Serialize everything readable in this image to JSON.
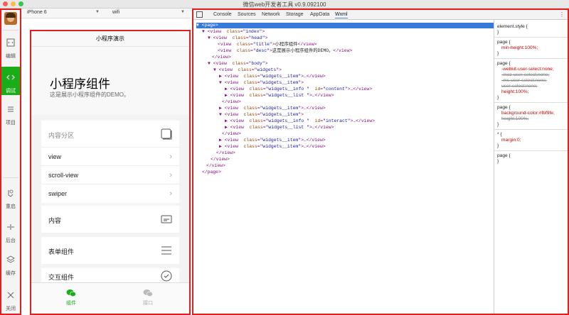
{
  "window": {
    "title": "微信web开发者工具 v0.9.092100"
  },
  "sidebar": {
    "items": [
      {
        "label": "编辑",
        "icon": "code-box-icon"
      },
      {
        "label": "调试",
        "icon": "code-brackets-icon",
        "active": true
      },
      {
        "label": "项目",
        "icon": "list-icon"
      },
      {
        "label": "重启",
        "icon": "restart-icon"
      },
      {
        "label": "后台",
        "icon": "background-icon"
      },
      {
        "label": "缓存",
        "icon": "layers-icon"
      },
      {
        "label": "关闭",
        "icon": "close-icon"
      }
    ]
  },
  "simulator": {
    "device": "iPhone 6",
    "network": "wifi",
    "nav_title": "小程序演示",
    "heading": "小程序组件",
    "desc": "这是展示小程序组件的DEMO。",
    "section_title": "内容分区",
    "section_items": [
      "view",
      "scroll-view",
      "swiper"
    ],
    "cards": [
      "内容",
      "表单组件",
      "交互组件"
    ],
    "tabs": [
      {
        "label": "组件",
        "active": true
      },
      {
        "label": "接口",
        "active": false
      }
    ]
  },
  "devtools": {
    "tabs": [
      "Console",
      "Sources",
      "Network",
      "Storage",
      "AppData",
      "Wxml"
    ],
    "selected_tab": "Wxml",
    "styles": {
      "element_style": "element.style {",
      "rule1_selector": "page {",
      "rule1_prop": "min-height:100%;",
      "rule2_selector": "page {",
      "rule2_props": [
        "-webkit-user-select:none;",
        "-moz-user-select:none;",
        "-ms-user-select:none;",
        "user-select:none;",
        "height:100%;"
      ],
      "rule3_selector": "page {",
      "rule3_props": [
        "background-color:#fbf9fe;",
        "height:100%;"
      ],
      "rule4_selector": "* {",
      "rule4_prop": "margin:0;",
      "rule5_selector": "page {",
      "close": "}"
    }
  },
  "colors": {
    "accent": "#1aad19",
    "highlight": "#e02020",
    "dom_select": "#3879d9"
  }
}
